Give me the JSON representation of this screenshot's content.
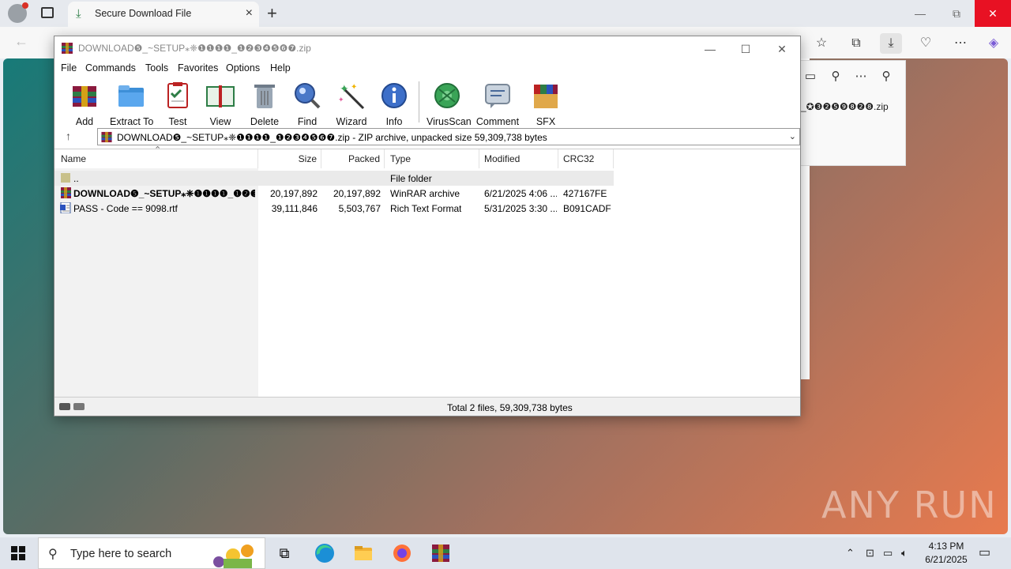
{
  "browser": {
    "tab_title": "Secure Download File",
    "minimize": "—",
    "restore": "⧉",
    "close": "✕"
  },
  "downloads_panel": {
    "file_name": "_✪❸❷❺❾❽❷❽.zip"
  },
  "winrar": {
    "title": "DOWNLOAD❺_~SETUP⁎❈❶❶❶❶_❶❷❸❹❺❻❼.zip",
    "menu": [
      "File",
      "Commands",
      "Tools",
      "Favorites",
      "Options",
      "Help"
    ],
    "toolbar": [
      "Add",
      "Extract To",
      "Test",
      "View",
      "Delete",
      "Find",
      "Wizard",
      "Info",
      "VirusScan",
      "Comment",
      "SFX"
    ],
    "path": "DOWNLOAD❺_~SETUP⁎❈❶❶❶❶_❶❷❸❹❺❻❼.zip - ZIP archive, unpacked size 59,309,738 bytes",
    "columns": [
      "Name",
      "Size",
      "Packed",
      "Type",
      "Modified",
      "CRC32"
    ],
    "rows": [
      {
        "name": "..",
        "size": "",
        "packed": "",
        "type": "File folder",
        "modified": "",
        "crc": ""
      },
      {
        "name": "DOWNLOAD❺_~SETUP⁎❈❶❶❶❶_❶❷❸...",
        "size": "20,197,892",
        "packed": "20,197,892",
        "type": "WinRAR archive",
        "modified": "6/21/2025 4:06 ...",
        "crc": "427167FE"
      },
      {
        "name": "PASS - Code == 9098.rtf",
        "size": "39,111,846",
        "packed": "5,503,767",
        "type": "Rich Text Format",
        "modified": "5/31/2025 3:30 ...",
        "crc": "B091CADF"
      }
    ],
    "status": "Total 2 files, 59,309,738 bytes"
  },
  "watermark": "ANY RUN",
  "taskbar": {
    "search_placeholder": "Type here to search",
    "time": "4:13 PM",
    "date": "6/21/2025"
  }
}
